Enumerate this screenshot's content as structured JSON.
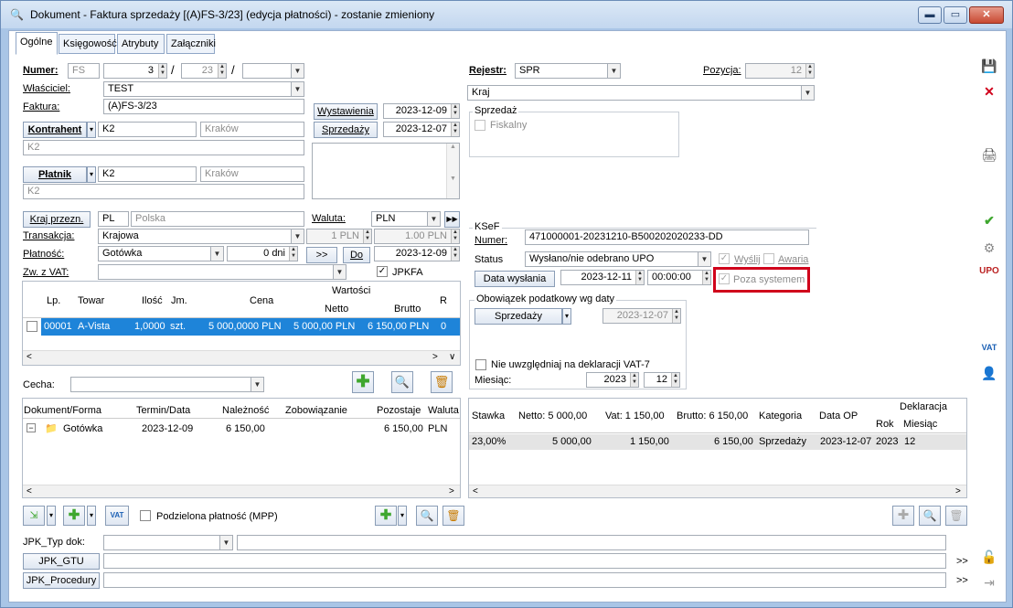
{
  "window": {
    "title": "Dokument - Faktura sprzedaży [(A)FS-3/23] (edycja płatności) - zostanie zmieniony",
    "controls": {
      "min": "▬",
      "max": "▭",
      "close": "✕"
    }
  },
  "tabs": [
    "Ogólne",
    "Księgowość",
    "Atrybuty",
    "Załączniki"
  ],
  "header": {
    "numer_label": "Numer:",
    "numer_prefix": "FS",
    "numer_value": "3",
    "numer_year": "23",
    "slash": "/",
    "wlasciciel_label": "Właściciel:",
    "wlasciciel_value": "TEST",
    "faktura_label": "Faktura:",
    "faktura_value": "(A)FS-3/23",
    "kontrahent_btn": "Kontrahent",
    "kontrahent_code": "K2",
    "kontrahent_city": "Kraków",
    "kontrahent_name": "K2",
    "platnik_btn": "Płatnik",
    "platnik_code": "K2",
    "platnik_city": "Kraków",
    "platnik_name": "K2",
    "wystawienia_btn": "Wystawienia",
    "wystawienia_date": "2023-12-09",
    "sprzedazy_btn": "Sprzedaży",
    "sprzedazy_date": "2023-12-07"
  },
  "rejestr": {
    "label": "Rejestr:",
    "value": "SPR",
    "pozycja_label": "Pozycja:",
    "pozycja_value": "12",
    "kraj": "Kraj",
    "sprzedaz_title": "Sprzedaż",
    "fiskalny": "Fiskalny"
  },
  "mid": {
    "kraj_btn": "Kraj przezn.",
    "kraj_code": "PL",
    "kraj_name": "Polska",
    "waluta_label": "Waluta:",
    "waluta_value": "PLN",
    "transakcja_label": "Transakcja:",
    "transakcja_value": "Krajowa",
    "kurs1": "1 PLN",
    "kurs2": "1.00 PLN",
    "platnosc_label": "Płatność:",
    "platnosc_value": "Gotówka",
    "dni": "0 dni",
    "arrow": ">>",
    "do_btn": "Do",
    "termin": "2023-12-09",
    "zw_label": "Zw. z VAT:",
    "jpkfa": "JPKFA"
  },
  "items": {
    "headers": {
      "lp": "Lp.",
      "towar": "Towar",
      "ilosc": "Ilość",
      "jm": "Jm.",
      "cena": "Cena",
      "wartosci": "Wartości",
      "netto": "Netto",
      "brutto": "Brutto",
      "r": "R"
    },
    "rows": [
      {
        "lp": "00001",
        "towar": "A-Vista",
        "ilosc": "1,0000",
        "jm": "szt.",
        "cena": "5 000,0000 PLN",
        "netto": "5 000,00 PLN",
        "brutto": "6 150,00 PLN",
        "r": "0"
      }
    ]
  },
  "cecha_label": "Cecha:",
  "payments": {
    "headers": {
      "doc": "Dokument/Forma",
      "termin": "Termin/Data",
      "nal": "Należność",
      "zob": "Zobowiązanie",
      "poz": "Pozostaje",
      "wal": "Waluta"
    },
    "rows": [
      {
        "doc": "Gotówka",
        "termin": "2023-12-09",
        "nal": "6 150,00",
        "zob": "",
        "poz": "6 150,00",
        "wal": "PLN"
      }
    ]
  },
  "ksef": {
    "title": "KSeF",
    "numer_label": "Numer:",
    "numer_value": "471000001-20231210-B500202020233-DD",
    "status_label": "Status",
    "status_value": "Wysłano/nie odebrano UPO",
    "wyslij": "Wyślij",
    "awaria": "Awaria",
    "data_btn": "Data wysłania",
    "data_value": "2023-12-11",
    "time_value": "00:00:00",
    "poza": "Poza systemem"
  },
  "obowiazek": {
    "title": "Obowiązek podatkowy wg daty",
    "btn": "Sprzedaży",
    "date": "2023-12-07",
    "nie_uwzgl": "Nie uwzględniaj na deklaracji VAT-7",
    "miesiac_label": "Miesiąc:",
    "rok": "2023",
    "mies": "12"
  },
  "vat_table": {
    "headers": {
      "stawka": "Stawka",
      "netto": "Netto: 5 000,00",
      "vat": "Vat: 1 150,00",
      "brutto": "Brutto: 6 150,00",
      "kat": "Kategoria",
      "data_op": "Data OP",
      "dekl": "Deklaracja",
      "rok": "Rok",
      "mies": "Miesiąc"
    },
    "rows": [
      {
        "stawka": "23,00%",
        "netto": "5 000,00",
        "vat": "1 150,00",
        "brutto": "6 150,00",
        "kat": "Sprzedaży",
        "data_op": "2023-12-07",
        "rok": "2023",
        "mies": "12"
      }
    ]
  },
  "bottom": {
    "vat_btn": "VAT",
    "mpp": "Podzielona płatność (MPP)",
    "jpk_typ": "JPK_Typ dok:",
    "jpk_gtu": "JPK_GTU",
    "jpk_proc": "JPK_Procedury",
    "more": ">>"
  },
  "colors": {
    "accent": "#1e84d9",
    "highlight": "#d0021b",
    "green": "#3fa72f"
  }
}
